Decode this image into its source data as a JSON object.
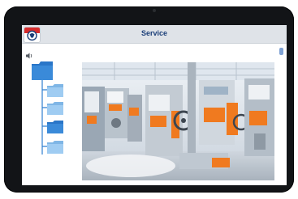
{
  "app": {
    "title": "Service"
  },
  "icons": {
    "logo": "app-logo",
    "volume": "speaker-icon",
    "root_folder": "folder-icon",
    "sub_folders": [
      "folder-icon",
      "folder-icon",
      "folder-icon",
      "folder-icon"
    ]
  },
  "tree": {
    "highlighted_index": 2
  },
  "colors": {
    "accent": "#1a3e78",
    "folder_dark": "#2f7fd0",
    "folder_light": "#8cc2ee",
    "bezel": "#121417"
  }
}
